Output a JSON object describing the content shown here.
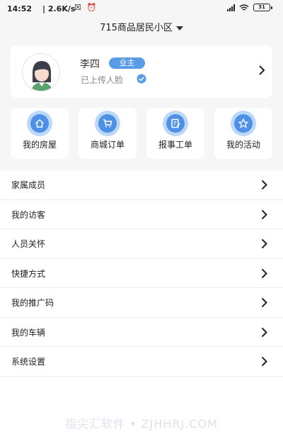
{
  "status_bar": {
    "time": "14:52",
    "speed": "| 2.6K/s",
    "notification_icons": "☒ ⏰",
    "battery": "31"
  },
  "header": {
    "community": "715商品居民小区"
  },
  "profile": {
    "name": "李四",
    "role": "业主",
    "face_status": "已上传人脸"
  },
  "quick_actions": [
    {
      "label": "我的房屋",
      "icon": "house-icon"
    },
    {
      "label": "商城订单",
      "icon": "cart-icon"
    },
    {
      "label": "报事工单",
      "icon": "work-order-icon"
    },
    {
      "label": "我的活动",
      "icon": "activity-icon"
    }
  ],
  "menu": [
    {
      "label": "家属成员"
    },
    {
      "label": "我的访客"
    },
    {
      "label": "人员关怀"
    },
    {
      "label": "快捷方式"
    },
    {
      "label": "我的推广码"
    },
    {
      "label": "我的车辆"
    },
    {
      "label": "系统设置"
    }
  ],
  "watermark": "指尖汇软件 • ZJHHRJ.COM",
  "colors": {
    "accent": "#4d90e6",
    "accent_light": "#bcd8f7",
    "background": "#f6f6f6",
    "badge": "#5a9be8"
  }
}
